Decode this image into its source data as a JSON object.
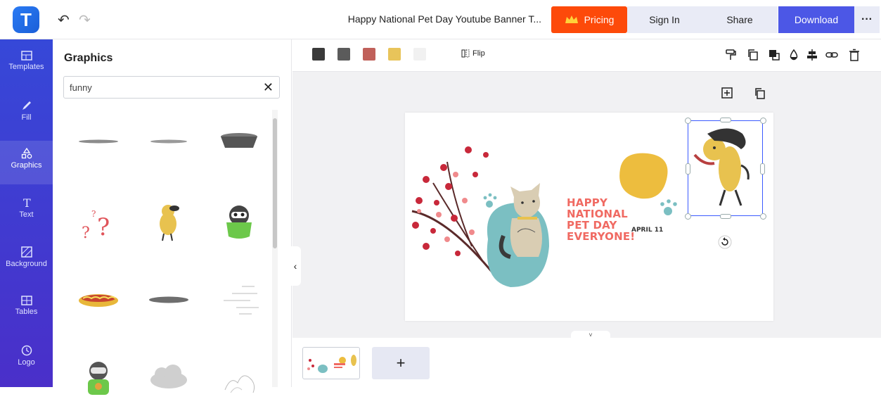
{
  "header": {
    "logo_letter": "T",
    "title": "Happy National Pet Day Youtube Banner T...",
    "buttons": {
      "pricing": "Pricing",
      "signin": "Sign In",
      "share": "Share",
      "download": "Download",
      "more": "···"
    }
  },
  "rail": {
    "items": [
      {
        "label": "Templates"
      },
      {
        "label": "Fill"
      },
      {
        "label": "Graphics"
      },
      {
        "label": "Text"
      },
      {
        "label": "Background"
      },
      {
        "label": "Tables"
      },
      {
        "label": "Logo"
      }
    ]
  },
  "panel": {
    "title": "Graphics",
    "search": {
      "value": "funny",
      "clear": "✕"
    }
  },
  "toolbar": {
    "swatches": [
      "#3a3a3a",
      "#5b5b5b",
      "#c0605a",
      "#e8c45a",
      "#f1f1f1"
    ],
    "flip_label": "Flip"
  },
  "canvas": {
    "banner_lines": [
      "HAPPY",
      "NATIONAL",
      "PET DAY",
      "EVERYONE!"
    ],
    "date": "APRIL 11",
    "collapse_glyph": "‹",
    "expand_glyph": "˅"
  },
  "pages": {
    "add_glyph": "+"
  },
  "colors": {
    "accent": "#4c57e6",
    "pricing": "#fd4a0a",
    "rail": "#3648d8",
    "banner_text": "#f06a62"
  }
}
